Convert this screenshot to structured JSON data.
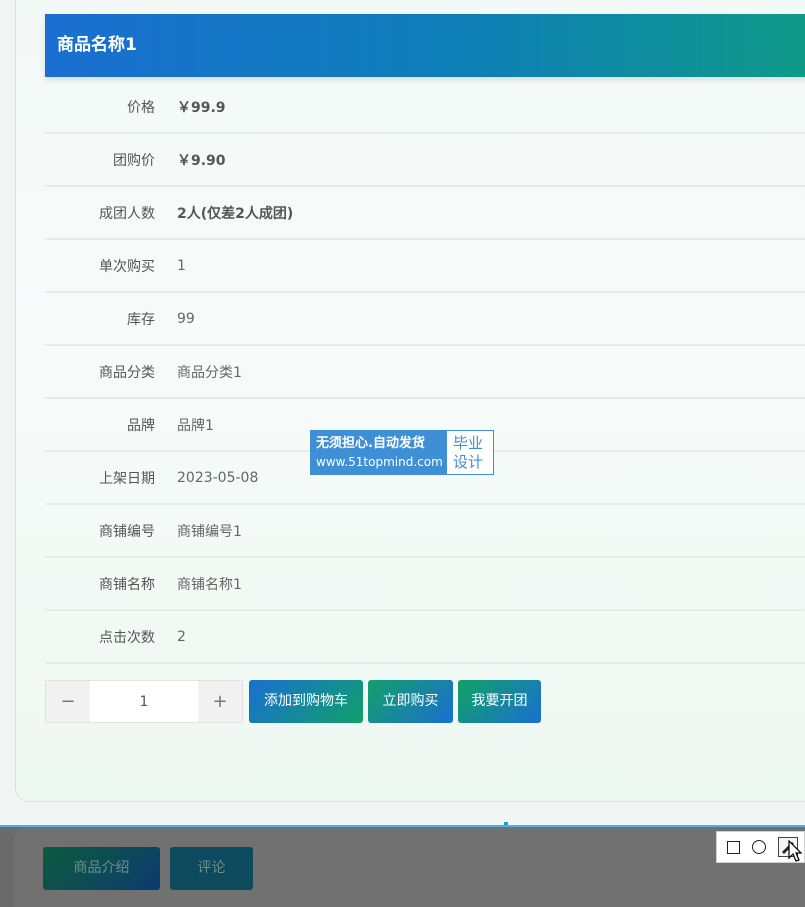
{
  "product": {
    "title": "商品名称1"
  },
  "details": [
    {
      "label": "价格",
      "value": "￥99.9",
      "bold": true
    },
    {
      "label": "团购价",
      "value": "￥9.90",
      "bold": true
    },
    {
      "label": "成团人数",
      "value": "2人(仅差2人成团)",
      "bold": true
    },
    {
      "label": "单次购买",
      "value": "1",
      "bold": false
    },
    {
      "label": "库存",
      "value": "99",
      "bold": false
    },
    {
      "label": "商品分类",
      "value": "商品分类1",
      "bold": false
    },
    {
      "label": "品牌",
      "value": "品牌1",
      "bold": false
    },
    {
      "label": "上架日期",
      "value": "2023-05-08",
      "bold": false
    },
    {
      "label": "商铺编号",
      "value": "商铺编号1",
      "bold": false
    },
    {
      "label": "商铺名称",
      "value": "商铺名称1",
      "bold": false
    },
    {
      "label": "点击次数",
      "value": "2",
      "bold": false
    }
  ],
  "quantity": {
    "minus": "−",
    "value": "1",
    "plus": "+"
  },
  "actions": {
    "add_to_cart": "添加到购物车",
    "buy_now": "立即购买",
    "start_group": "我要开团"
  },
  "watermark": {
    "line1": "无须担心.自动发货",
    "line2": "www.51topmind.com",
    "right1": "毕业",
    "right2": "设计"
  },
  "tabs": {
    "intro": "商品介绍",
    "review": "评论"
  },
  "tools": {
    "square_icon": "square-icon",
    "circle_icon": "circle-icon",
    "pen_icon": "pen-icon"
  },
  "colors": {
    "title_start": "#1a6fd1",
    "title_end": "#0f9b86",
    "watermark": "#3f8fd6"
  }
}
